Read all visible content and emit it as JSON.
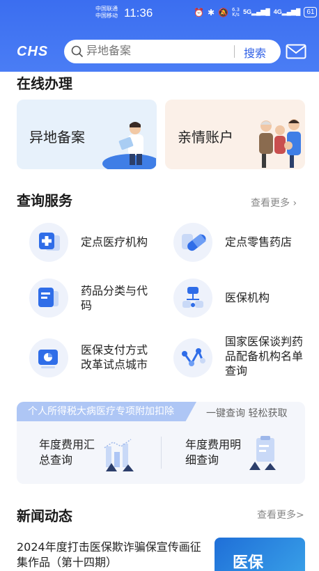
{
  "status_bar": {
    "carrier1": "中国联通",
    "carrier2": "中国移动",
    "time": "11:36",
    "speed_value": "6.3",
    "speed_unit": "K/s",
    "net1": "5G",
    "net2": "4G",
    "battery": "61"
  },
  "header": {
    "logo": "CHS",
    "search_placeholder": "异地备案",
    "search_button": "搜索"
  },
  "online": {
    "title": "在线办理",
    "cards": [
      {
        "label": "异地备案"
      },
      {
        "label": "亲情账户"
      }
    ]
  },
  "query": {
    "title": "查询服务",
    "more": "查看更多 ›",
    "items": [
      {
        "label": "定点医疗机构"
      },
      {
        "label": "定点零售药店"
      },
      {
        "label": "药品分类与代码"
      },
      {
        "label": "医保机构"
      },
      {
        "label": "医保支付方式改革试点城市"
      },
      {
        "label": "国家医保谈判药品配备机构名单查询"
      }
    ]
  },
  "tax": {
    "banner": "个人所得税大病医疗专项附加扣除",
    "right": "一键查询 轻松获取",
    "items": [
      {
        "label": "年度费用汇总查询"
      },
      {
        "label": "年度费用明细查询"
      }
    ]
  },
  "news": {
    "title": "新闻动态",
    "more": "查看更多>",
    "item_title": "2024年度打击医保欺诈骗保宣传画征集作品（第十四期）",
    "thumb_text": "医保"
  },
  "colors": {
    "primary": "#3b6ef0",
    "accent_blue": "#2e5fe6",
    "icon_bg": "#eef2fb"
  }
}
